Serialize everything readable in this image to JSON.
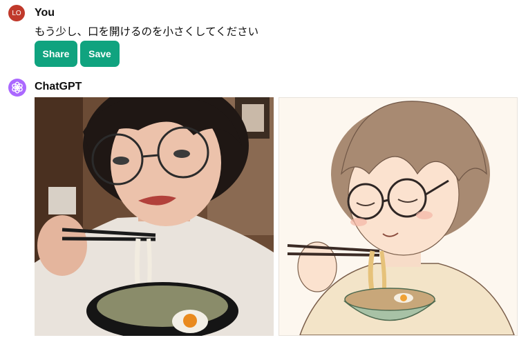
{
  "user": {
    "avatar_initials": "LO",
    "name": "You",
    "message": "もう少し、口を開けるのを小さくしてください"
  },
  "actions": {
    "share_label": "Share",
    "save_label": "Save"
  },
  "assistant": {
    "name": "ChatGPT",
    "logo_icon": "openai-flower-icon"
  },
  "images": [
    {
      "kind": "photorealistic-woman-eating-ramen"
    },
    {
      "kind": "illustrated-woman-eating-ramen"
    }
  ],
  "colors": {
    "accent": "#10a37f",
    "user_avatar": "#c0392b",
    "assistant_avatar": "#ab68ff"
  }
}
